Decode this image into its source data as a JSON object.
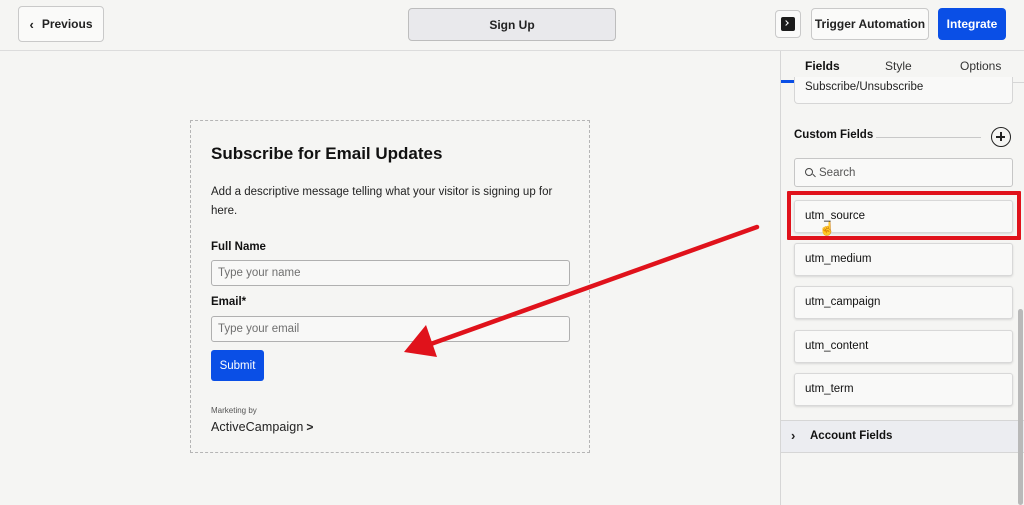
{
  "topbar": {
    "previous_label": "Previous",
    "page_tab_label": "Sign Up",
    "trigger_label": "Trigger Automation",
    "integrate_label": "Integrate"
  },
  "form": {
    "title": "Subscribe for Email Updates",
    "description": "Add a descriptive message telling what your visitor is signing up for here.",
    "full_name_label": "Full Name",
    "full_name_placeholder": "Type your name",
    "email_label": "Email*",
    "email_placeholder": "Type your email",
    "submit_label": "Submit",
    "marketing_by": "Marketing by",
    "brand": "ActiveCampaign",
    "brand_chevron": ">"
  },
  "panel": {
    "tabs": [
      {
        "label": "Fields",
        "active": true
      },
      {
        "label": "Style",
        "active": false
      },
      {
        "label": "Options",
        "active": false
      }
    ],
    "subscribe_item": "Subscribe/Unsubscribe",
    "custom_fields_title": "Custom Fields",
    "search_placeholder": "Search",
    "custom_fields": [
      "utm_source",
      "utm_medium",
      "utm_campaign",
      "utm_content",
      "utm_term"
    ],
    "account_fields_label": "Account Fields"
  },
  "colors": {
    "accent_blue": "#0a4fe6",
    "annotation_red": "#e0121b"
  },
  "icons": {
    "previous": "chevron-left-icon",
    "terminal": "terminal-icon",
    "add": "plus-circle-icon",
    "search": "search-icon",
    "cursor": "hand-pointer-icon",
    "account_expand": "chevron-right-icon"
  }
}
